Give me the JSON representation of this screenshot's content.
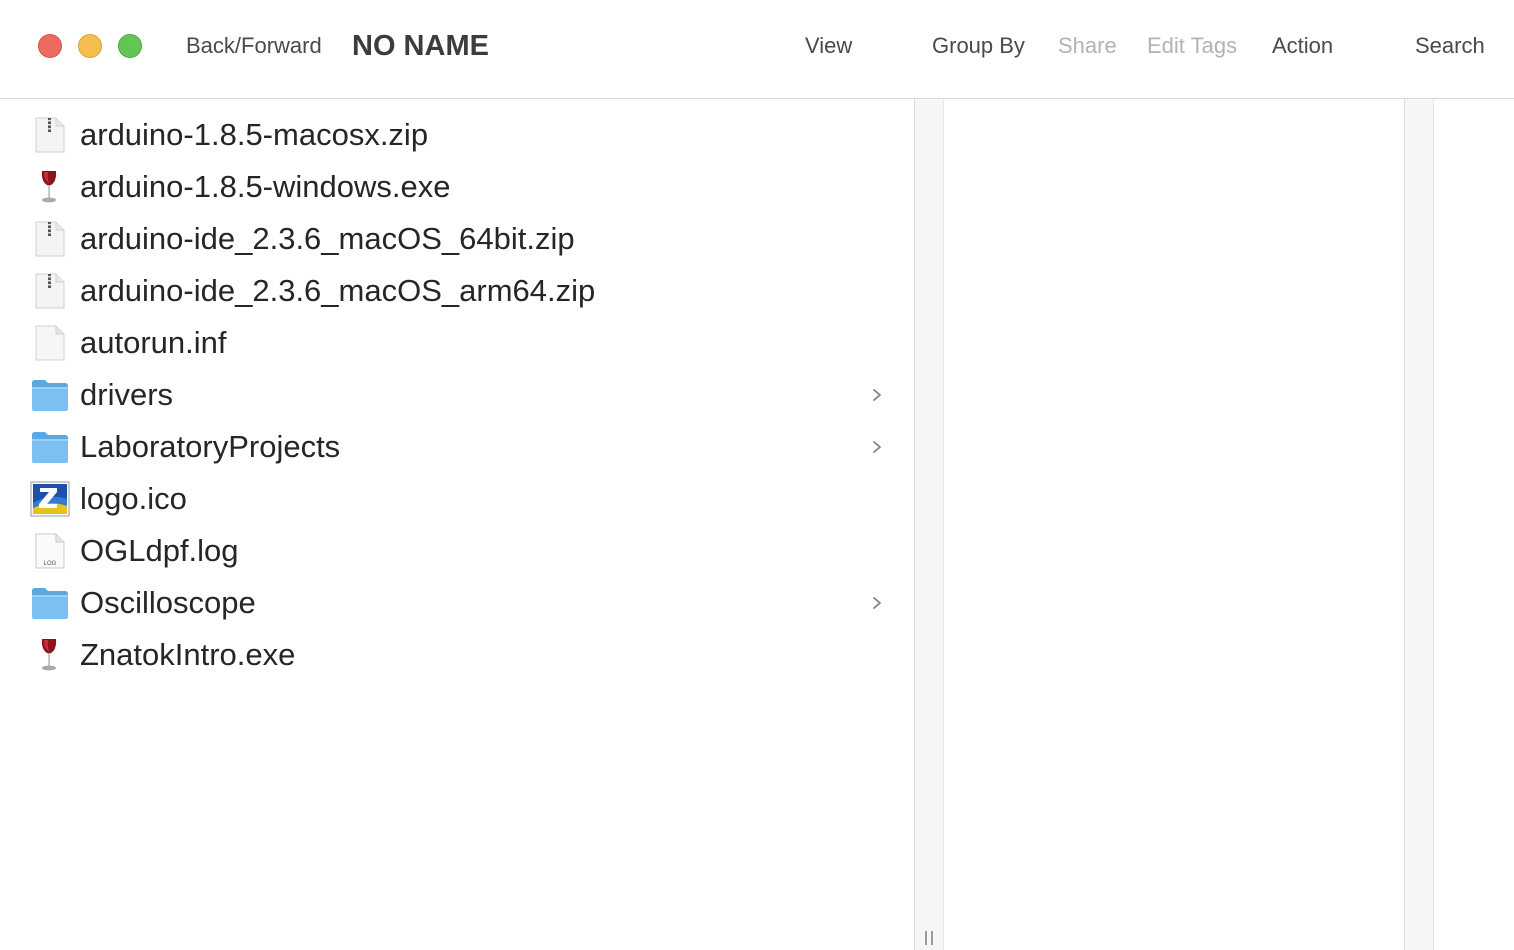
{
  "toolbar": {
    "back_forward": "Back/Forward",
    "title": "NO NAME",
    "view": "View",
    "group_by": "Group By",
    "share": "Share",
    "edit_tags": "Edit Tags",
    "action": "Action",
    "search": "Search"
  },
  "colors": {
    "close": "#ed6a5e",
    "minimize": "#f5bf4f",
    "zoom": "#62c554",
    "folder": "#7cc0f2",
    "disabled_text": "#b3b3b3"
  },
  "files": [
    {
      "name": "arduino-1.8.5-macosx.zip",
      "icon": "zip-archive-icon",
      "is_folder": false
    },
    {
      "name": "arduino-1.8.5-windows.exe",
      "icon": "wine-exe-icon",
      "is_folder": false
    },
    {
      "name": "arduino-ide_2.3.6_macOS_64bit.zip",
      "icon": "zip-archive-icon",
      "is_folder": false
    },
    {
      "name": "arduino-ide_2.3.6_macOS_arm64.zip",
      "icon": "zip-archive-icon",
      "is_folder": false
    },
    {
      "name": "autorun.inf",
      "icon": "blank-document-icon",
      "is_folder": false
    },
    {
      "name": "drivers",
      "icon": "folder-icon",
      "is_folder": true
    },
    {
      "name": "LaboratoryProjects",
      "icon": "folder-icon",
      "is_folder": true
    },
    {
      "name": "logo.ico",
      "icon": "ico-image-icon",
      "is_folder": false
    },
    {
      "name": "OGLdpf.log",
      "icon": "log-document-icon",
      "is_folder": false,
      "icon_label": "LOG"
    },
    {
      "name": "Oscilloscope",
      "icon": "folder-icon",
      "is_folder": true
    },
    {
      "name": "ZnatokIntro.exe",
      "icon": "wine-exe-icon",
      "is_folder": false
    }
  ]
}
